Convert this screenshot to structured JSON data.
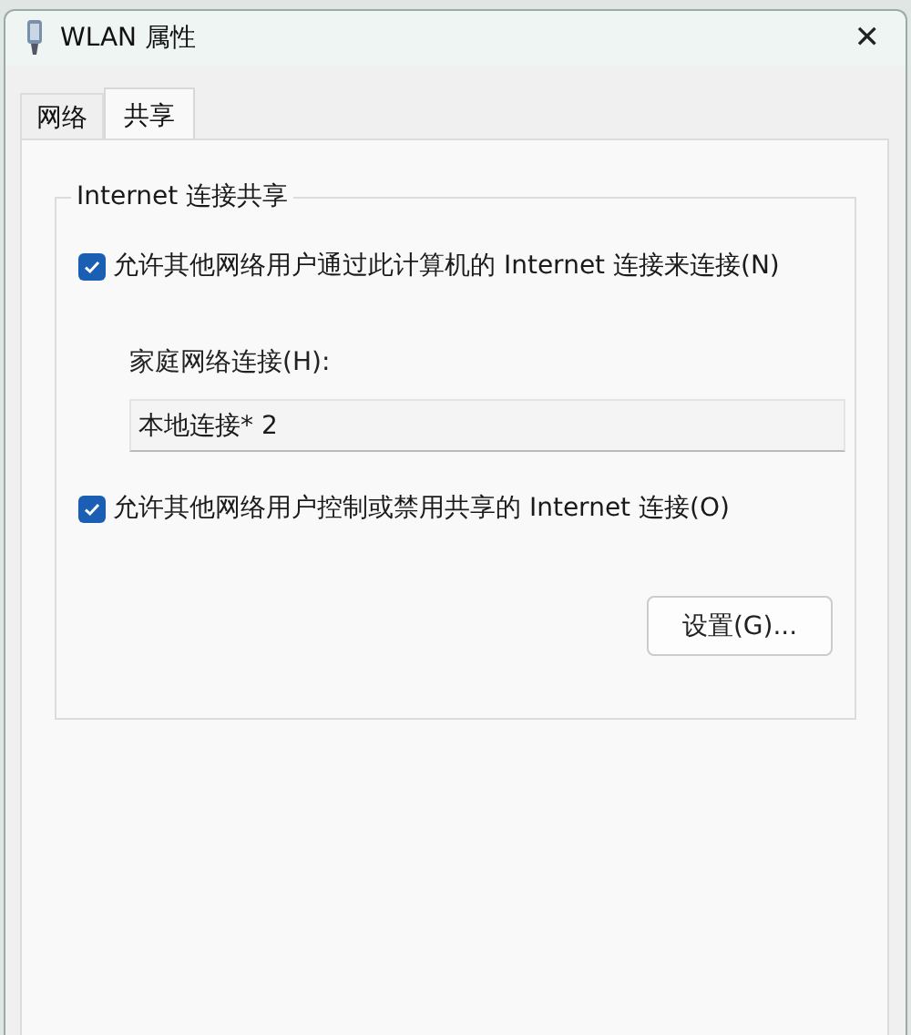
{
  "window": {
    "title": "WLAN 属性",
    "close": "✕"
  },
  "tabs": [
    {
      "label": "网络",
      "selected": false
    },
    {
      "label": "共享",
      "selected": true
    }
  ],
  "group": {
    "title": "Internet 连接共享",
    "options": [
      {
        "label": "允许其他网络用户通过此计算机的 Internet 连接来连接(N)",
        "checked": true
      },
      {
        "label": "允许其他网络用户控制或禁用共享的 Internet 连接(O)",
        "checked": true
      }
    ],
    "home_connection": {
      "label": "家庭网络连接(H):",
      "value": "本地连接* 2"
    },
    "buttons": [
      "设置(G)..."
    ]
  }
}
